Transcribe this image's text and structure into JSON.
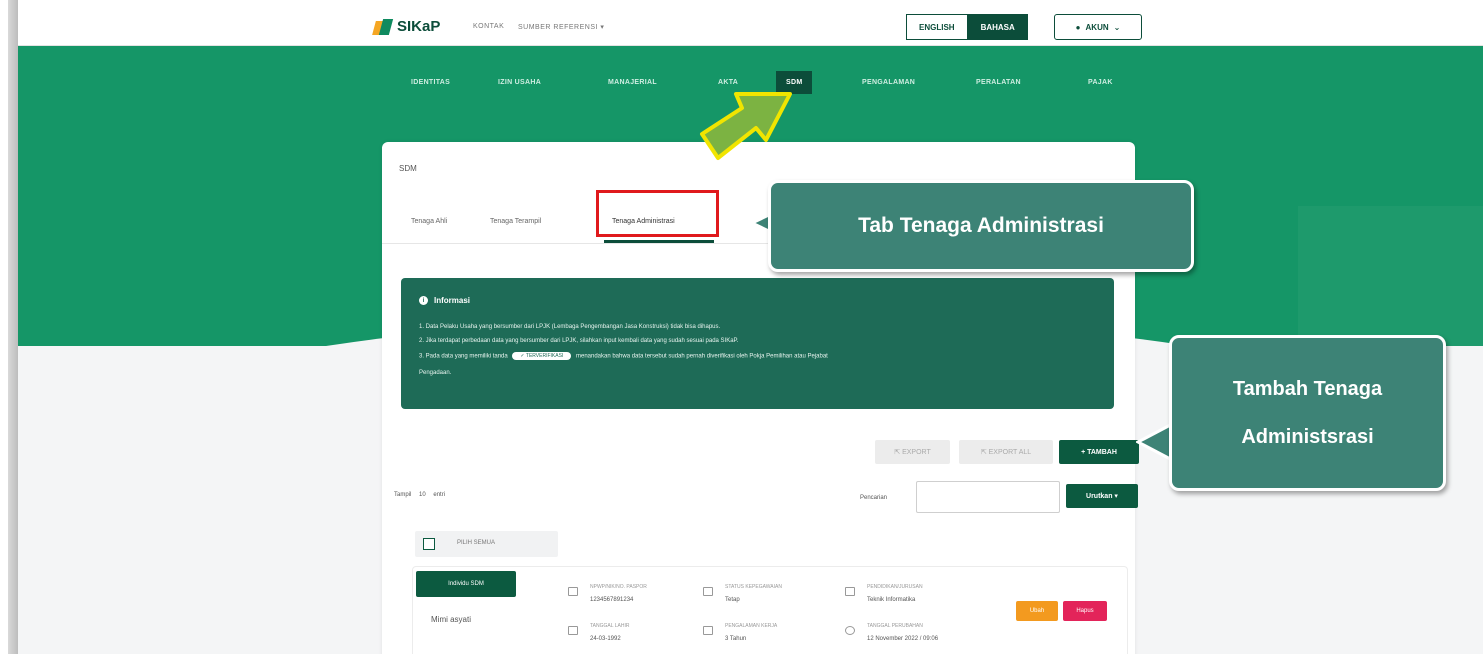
{
  "app": {
    "logo_text": "SIKaP",
    "top_links": [
      "KONTAK",
      "SUMBER REFERENSI ▾"
    ],
    "languages": [
      "ENGLISH",
      "BAHASA"
    ],
    "active_language": "BAHASA",
    "account_label": "AKUN"
  },
  "menu": {
    "items": [
      "IDENTITAS",
      "IZIN USAHA",
      "MANAJERIAL",
      "AKTA",
      "SDM",
      "PENGALAMAN",
      "PERALATAN",
      "PAJAK"
    ],
    "active": "SDM"
  },
  "card": {
    "title": "SDM",
    "tabs": [
      "Tenaga Ahli",
      "Tenaga Terampil",
      "Tenaga Administrasi"
    ],
    "active_tab": "Tenaga Administrasi"
  },
  "info": {
    "heading": "Informasi",
    "line1": "1. Data Pelaku Usaha yang bersumber dari LPJK (Lembaga Pengembangan Jasa Konstruksi) tidak bisa dihapus.",
    "line2": "2. Jika terdapat perbedaan data yang bersumber dari LPJK, silahkan input kembali data yang sudah sesuai pada SIKaP.",
    "line3_pre": "3. Pada data yang memiliki tanda",
    "line3_pill": "✓ TERVERIFIKASI",
    "line3_post": "menandakan bahwa data tersebut sudah pernah diverifikasi oleh Pokja Pemilihan atau Pejabat",
    "line4": "Pengadaan."
  },
  "toolbar": {
    "export": "EXPORT",
    "export_all": "EXPORT ALL",
    "tambah": "+ TAMBAH"
  },
  "listing": {
    "tampil_pre": "Tampil",
    "tampil_value": "10",
    "tampil_post": "entri",
    "search_label": "Pencarian",
    "sort_button": "Urutkan ▾",
    "pilih_semua": "PILIH SEMUA"
  },
  "row": {
    "badge": "Individu SDM",
    "name": "Mimi asyati",
    "fields": [
      {
        "label": "NPWP/NIK/NO. PASPOR",
        "value": "1234567891234"
      },
      {
        "label": "STATUS KEPEGAWAIAN",
        "value": "Tetap"
      },
      {
        "label": "PENDIDIKAN/JURUSAN",
        "value": "Teknik Informatika"
      },
      {
        "label": "TANGGAL LAHIR",
        "value": "24-03-1992"
      },
      {
        "label": "PENGALAMAN KERJA",
        "value": "3 Tahun"
      },
      {
        "label": "TANGGAL PERUBAHAN",
        "value": "12 November 2022 / 09:06"
      }
    ],
    "edit_label": "Ubah",
    "delete_label": "Hapus"
  },
  "callouts": {
    "tab": "Tab Tenaga Administrasi",
    "tambah_line1": "Tambah Tenaga",
    "tambah_line2": "Administsrasi"
  },
  "colors": {
    "brand_green": "#159667",
    "dark_green": "#0c4d3a",
    "callout": "#3d8376",
    "highlight_red": "#e0191c",
    "arrow": "#7cb342"
  }
}
